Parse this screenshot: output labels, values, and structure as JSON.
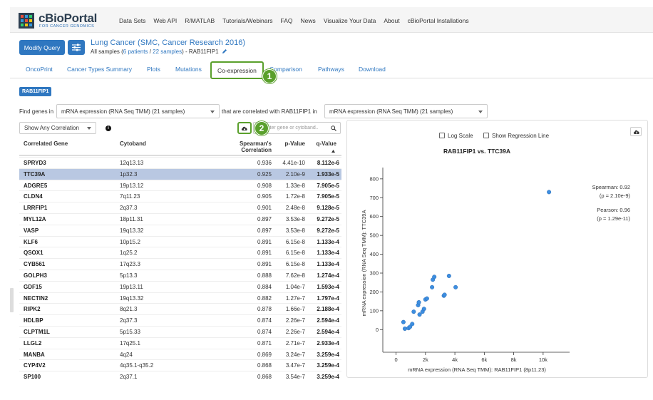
{
  "header": {
    "logo_text": "cBioPortal",
    "logo_sub": "FOR CANCER GENOMICS",
    "nav": [
      "Data Sets",
      "Web API",
      "R/MATLAB",
      "Tutorials/Webinars",
      "FAQ",
      "News",
      "Visualize Your Data",
      "About",
      "cBioPortal Installations"
    ]
  },
  "study": {
    "modify_query": "Modify Query",
    "title": "Lung Cancer (SMC, Cancer Research 2016)",
    "sub_prefix": "All samples (",
    "patients": "6 patients",
    "sep": " / ",
    "samples": "22 samples",
    "sub_suffix": ")  - RAB11FIP1"
  },
  "tabs": [
    "OncoPrint",
    "Cancer Types Summary",
    "Plots",
    "Mutations",
    "Co-expression",
    "Comparison",
    "Pathways",
    "Download"
  ],
  "active_tab": "Co-expression",
  "annotations": {
    "one": "1",
    "two": "2"
  },
  "gene_pill": "RAB11FIP1",
  "find": {
    "prefix": "Find genes in",
    "profile1": "mRNA expression (RNA Seq TMM) (21 samples)",
    "middle": "that are correlated with RAB11FIP1 in",
    "profile2": "mRNA expression (RNA Seq TMM) (21 samples)"
  },
  "controls": {
    "correlation_filter": "Show Any Correlation",
    "search_placeholder": "Enter gene or cytoband.."
  },
  "table": {
    "headers": {
      "gene": "Correlated Gene",
      "cyto": "Cytoband",
      "rho1": "Spearman's",
      "rho2": "Correlation",
      "p": "p-Value",
      "q": "q-Value"
    },
    "selected_index": 1,
    "rows": [
      {
        "gene": "SPRYD3",
        "cyto": "12q13.13",
        "rho": "0.936",
        "p": "4.41e-10",
        "q": "8.112e-6"
      },
      {
        "gene": "TTC39A",
        "cyto": "1p32.3",
        "rho": "0.925",
        "p": "2.10e-9",
        "q": "1.933e-5"
      },
      {
        "gene": "ADGRE5",
        "cyto": "19p13.12",
        "rho": "0.908",
        "p": "1.33e-8",
        "q": "7.905e-5"
      },
      {
        "gene": "CLDN4",
        "cyto": "7q11.23",
        "rho": "0.905",
        "p": "1.72e-8",
        "q": "7.905e-5"
      },
      {
        "gene": "LRRFIP1",
        "cyto": "2q37.3",
        "rho": "0.901",
        "p": "2.48e-8",
        "q": "9.128e-5"
      },
      {
        "gene": "MYL12A",
        "cyto": "18p11.31",
        "rho": "0.897",
        "p": "3.53e-8",
        "q": "9.272e-5"
      },
      {
        "gene": "VASP",
        "cyto": "19q13.32",
        "rho": "0.897",
        "p": "3.53e-8",
        "q": "9.272e-5"
      },
      {
        "gene": "KLF6",
        "cyto": "10p15.2",
        "rho": "0.891",
        "p": "6.15e-8",
        "q": "1.133e-4"
      },
      {
        "gene": "QSOX1",
        "cyto": "1q25.2",
        "rho": "0.891",
        "p": "6.15e-8",
        "q": "1.133e-4"
      },
      {
        "gene": "CYB561",
        "cyto": "17q23.3",
        "rho": "0.891",
        "p": "6.15e-8",
        "q": "1.133e-4"
      },
      {
        "gene": "GOLPH3",
        "cyto": "5p13.3",
        "rho": "0.888",
        "p": "7.62e-8",
        "q": "1.274e-4"
      },
      {
        "gene": "GDF15",
        "cyto": "19p13.11",
        "rho": "0.884",
        "p": "1.04e-7",
        "q": "1.593e-4"
      },
      {
        "gene": "NECTIN2",
        "cyto": "19q13.32",
        "rho": "0.882",
        "p": "1.27e-7",
        "q": "1.797e-4"
      },
      {
        "gene": "RIPK2",
        "cyto": "8q21.3",
        "rho": "0.878",
        "p": "1.66e-7",
        "q": "2.188e-4"
      },
      {
        "gene": "HDLBP",
        "cyto": "2q37.3",
        "rho": "0.874",
        "p": "2.26e-7",
        "q": "2.594e-4"
      },
      {
        "gene": "CLPTM1L",
        "cyto": "5p15.33",
        "rho": "0.874",
        "p": "2.26e-7",
        "q": "2.594e-4"
      },
      {
        "gene": "LLGL2",
        "cyto": "17q25.1",
        "rho": "0.871",
        "p": "2.71e-7",
        "q": "2.933e-4"
      },
      {
        "gene": "MANBA",
        "cyto": "4q24",
        "rho": "0.869",
        "p": "3.24e-7",
        "q": "3.259e-4"
      },
      {
        "gene": "CYP4V2",
        "cyto": "4q35.1-q35.2",
        "rho": "0.868",
        "p": "3.47e-7",
        "q": "3.259e-4"
      },
      {
        "gene": "SP100",
        "cyto": "2q37.1",
        "rho": "0.868",
        "p": "3.54e-7",
        "q": "3.259e-4"
      }
    ]
  },
  "plot": {
    "log_scale_label": "Log Scale",
    "regression_label": "Show Regression Line",
    "stats": {
      "spearman": "Spearman: 0.92",
      "spearman_p": "(p = 2.10e-9)",
      "pearson": "Pearson: 0.96",
      "pearson_p": "(p = 1.29e-11)"
    }
  },
  "chart_data": {
    "type": "scatter",
    "title": "RAB11FIP1 vs. TTC39A",
    "xlabel": "mRNA expression (RNA Seq TMM): RAB11FIP1 (8p11.23)",
    "ylabel": "mRNA expression (RNA Seq TMM): TTC39A",
    "xlim": [
      -900,
      11800
    ],
    "ylim": [
      -120,
      860
    ],
    "x_ticks": [
      0,
      2000,
      4000,
      6000,
      8000,
      10000
    ],
    "x_tick_labels": [
      "0",
      "2k",
      "4k",
      "6k",
      "8k",
      "10k"
    ],
    "y_ticks": [
      0,
      100,
      200,
      300,
      400,
      500,
      600,
      700,
      800
    ],
    "y_tick_labels": [
      "0",
      "100",
      "200",
      "300",
      "400",
      "500",
      "600",
      "700",
      "800"
    ],
    "point_color": "#3d8ee0",
    "points": [
      {
        "x": 500,
        "y": 40
      },
      {
        "x": 600,
        "y": 5
      },
      {
        "x": 850,
        "y": 8
      },
      {
        "x": 950,
        "y": 15
      },
      {
        "x": 1100,
        "y": 30
      },
      {
        "x": 1200,
        "y": 95
      },
      {
        "x": 1500,
        "y": 130
      },
      {
        "x": 1550,
        "y": 145
      },
      {
        "x": 1600,
        "y": 80
      },
      {
        "x": 1800,
        "y": 95
      },
      {
        "x": 1900,
        "y": 110
      },
      {
        "x": 2000,
        "y": 160
      },
      {
        "x": 2100,
        "y": 165
      },
      {
        "x": 2450,
        "y": 225
      },
      {
        "x": 2500,
        "y": 265
      },
      {
        "x": 2600,
        "y": 280
      },
      {
        "x": 3250,
        "y": 180
      },
      {
        "x": 3300,
        "y": 185
      },
      {
        "x": 3600,
        "y": 285
      },
      {
        "x": 4050,
        "y": 225
      },
      {
        "x": 10400,
        "y": 730
      }
    ]
  }
}
